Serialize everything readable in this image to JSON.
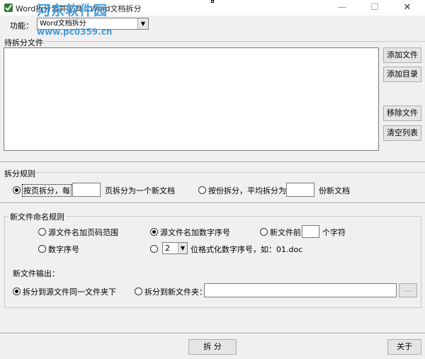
{
  "window": {
    "title": "Word拆分合并工具 - Word文档拆分",
    "watermark": "河东软件园",
    "watermark_url": "www.pc0359.cn",
    "minimize": "—",
    "maximize": "☐",
    "close": "✕"
  },
  "function": {
    "label": "功能：",
    "selected": "Word文档拆分",
    "arrow": "▼"
  },
  "files": {
    "group_label": "待拆分文件",
    "buttons": {
      "add_file": "添加文件",
      "add_dir": "添加目录",
      "remove": "移除文件",
      "clear": "清空列表"
    }
  },
  "split_rule": {
    "group_label": "拆分规则",
    "by_page_label": "按页拆分，每",
    "by_page_suffix": "页拆分为一个新文档",
    "by_page_value": "",
    "by_part_label": "按份拆分，平均拆分为",
    "by_part_suffix": "份新文档",
    "by_part_value": "",
    "selected": "by_page"
  },
  "naming": {
    "group_label": "新文件命名规则",
    "opt_page_range": "源文件名加页码范围",
    "opt_seq_suffix": "源文件名加数字序号",
    "opt_prefix": "新文件前",
    "opt_prefix_suffix": "个字符",
    "opt_prefix_value": "",
    "opt_seq": "数字序号",
    "format_value": "2",
    "format_text": "位格式化数字序号，如：01.doc",
    "selected": "seq_suffix"
  },
  "output": {
    "label": "新文件输出：",
    "opt_same_folder": "拆分到源文件同一文件夹下",
    "opt_new_folder": "拆分到新文件夹：",
    "path_value": "",
    "browse": "...",
    "selected": "same_folder"
  },
  "actions": {
    "split": "拆 分",
    "about": "关于"
  },
  "colors": {
    "watermark": "#2d8fd6",
    "window_bg": "#f0f0f0"
  }
}
